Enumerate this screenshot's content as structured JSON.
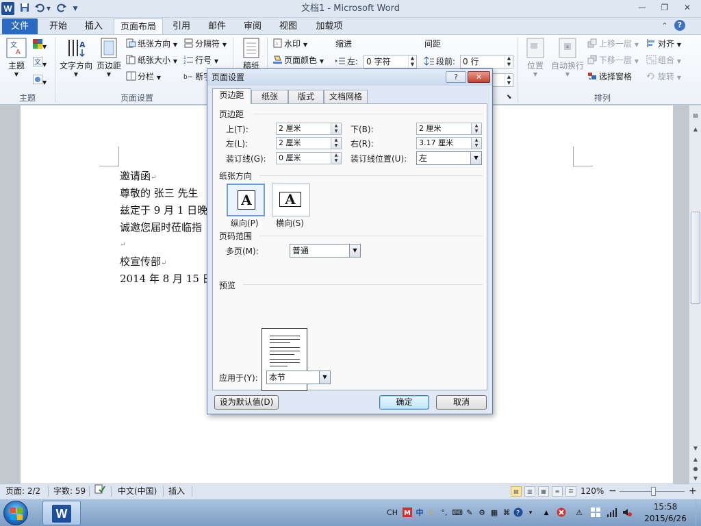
{
  "window": {
    "title": "文档1 - Microsoft Word",
    "app_icon": "W",
    "minimize": "—",
    "restore": "❐",
    "close": "✕"
  },
  "qat": {
    "save_icon": "save-icon",
    "undo_icon": "undo-icon",
    "redo_icon": "redo-icon"
  },
  "ribbon_tabs": {
    "file": "文件",
    "items": [
      "开始",
      "插入",
      "页面布局",
      "引用",
      "邮件",
      "审阅",
      "视图",
      "加载项"
    ],
    "active_index": 2,
    "help": "?"
  },
  "ribbon": {
    "themes": {
      "label": "主题",
      "big_button": "主题"
    },
    "page_setup": {
      "label": "页面设置",
      "text_direction": "文字方向",
      "margins": "页边距",
      "orientation": "纸张方向",
      "size": "纸张大小",
      "columns": "分栏",
      "breaks": "分隔符",
      "line_numbers": "行号",
      "hyphenation": "断字",
      "manuscript": "稿纸"
    },
    "background": {
      "watermark": "水印",
      "page_color": "页面颜色"
    },
    "paragraph": {
      "indent_header": "缩进",
      "spacing_header": "间距",
      "indent_left_label": "左:",
      "indent_left_value": "0 字符",
      "spacing_before_label": "段前:",
      "spacing_before_value": "0 行"
    },
    "arrange": {
      "label": "排列",
      "position": "位置",
      "wrap_text": "自动换行",
      "bring_forward": "上移一层",
      "send_backward": "下移一层",
      "selection_pane": "选择窗格",
      "align": "对齐",
      "group": "组合",
      "rotate": "旋转"
    }
  },
  "document": {
    "lines": [
      "邀请函",
      "尊敬的 张三 先生",
      "兹定于 9 月 1 日晚",
      "诚邀您届时莅临指",
      "",
      "校宣传部",
      "2014 年 8 月 15 日"
    ],
    "para_mark": "↵"
  },
  "dialog": {
    "title": "页面设置",
    "help_button": "?",
    "close_button": "✕",
    "tabs": [
      "页边距",
      "纸张",
      "版式",
      "文档网格"
    ],
    "active_tab": 0,
    "margins_section": "页边距",
    "top_label": "上(T):",
    "top_value": "2 厘米",
    "bottom_label": "下(B):",
    "bottom_value": "2 厘米",
    "left_label": "左(L):",
    "left_value": "2 厘米",
    "right_label": "右(R):",
    "right_value": "3.17 厘米",
    "gutter_label": "装订线(G):",
    "gutter_value": "0 厘米",
    "gutter_pos_label": "装订线位置(U):",
    "gutter_pos_value": "左",
    "orientation_section": "纸张方向",
    "portrait_label": "纵向(P)",
    "landscape_label": "横向(S)",
    "orientation_glyph": "A",
    "selected_orientation": "portrait",
    "pages_section": "页码范围",
    "multiple_pages_label": "多页(M):",
    "multiple_pages_value": "普通",
    "preview_section": "预览",
    "apply_to_label": "应用于(Y):",
    "apply_to_value": "本节",
    "set_default_button": "设为默认值(D)",
    "ok_button": "确定",
    "cancel_button": "取消"
  },
  "status_bar": {
    "page": "页面: 2/2",
    "words": "字数: 59",
    "language": "中文(中国)",
    "mode": "插入",
    "zoom": "120%",
    "zoom_minus": "−",
    "zoom_plus": "+",
    "zoom_level_percent": 120
  },
  "taskbar": {
    "lang": "CH",
    "time": "15:58",
    "date": "2015/6/26",
    "word_task": "W"
  }
}
